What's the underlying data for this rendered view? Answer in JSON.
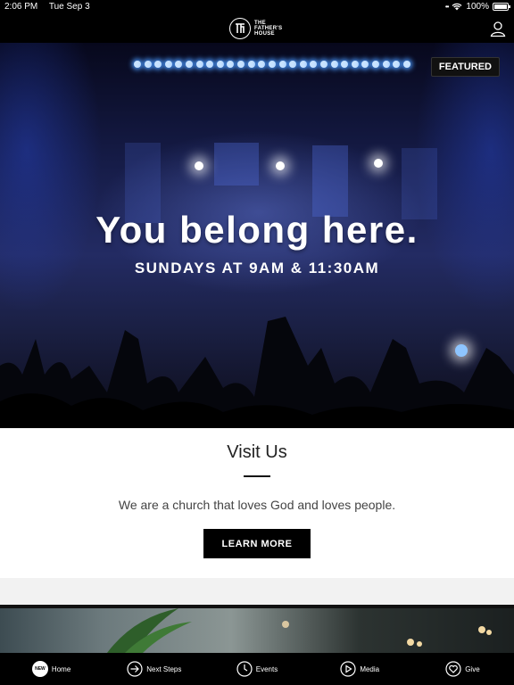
{
  "status_bar": {
    "time": "2:06 PM",
    "date": "Tue Sep 3",
    "battery": "100%"
  },
  "header": {
    "logo_line1": "THE",
    "logo_line2": "FATHER'S",
    "logo_line3": "HOUSE"
  },
  "hero": {
    "badge": "FEATURED",
    "title": "You belong here.",
    "subtitle": "SUNDAYS AT 9AM & 11:30AM"
  },
  "card": {
    "title": "Visit Us",
    "body": "We are a church that loves God and loves people.",
    "button": "LEARN MORE"
  },
  "tabs": [
    {
      "label": "Home",
      "icon": "new-badge-icon",
      "badge": "NEW"
    },
    {
      "label": "Next Steps",
      "icon": "arrow-circle-icon"
    },
    {
      "label": "Events",
      "icon": "clock-icon"
    },
    {
      "label": "Media",
      "icon": "play-circle-icon"
    },
    {
      "label": "Give",
      "icon": "heart-circle-icon"
    }
  ]
}
